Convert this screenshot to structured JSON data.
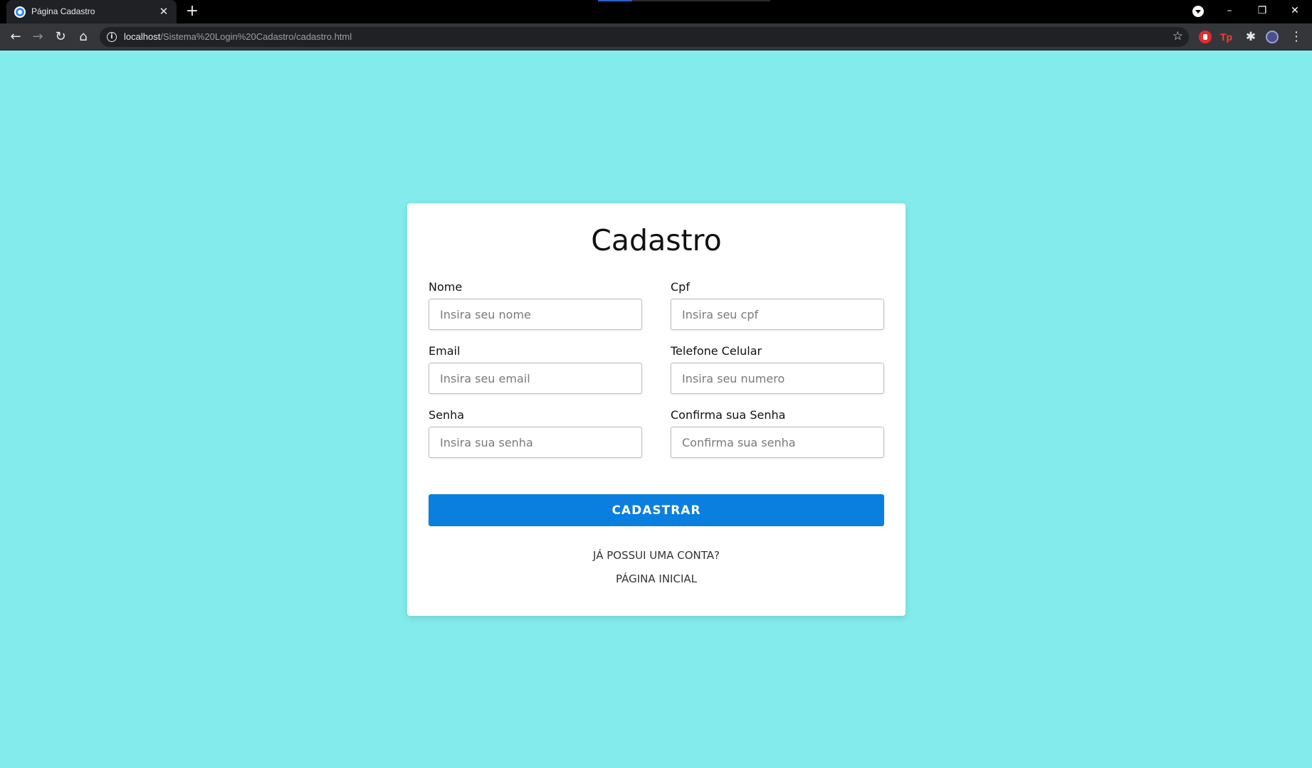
{
  "browser": {
    "tab_title": "Página Cadastro",
    "url_host": "localhost",
    "url_path": "/Sistema%20Login%20Cadastro/cadastro.html"
  },
  "form": {
    "title": "Cadastro",
    "fields": [
      {
        "label": "Nome",
        "placeholder": "Insira seu nome"
      },
      {
        "label": "Cpf",
        "placeholder": "Insira seu cpf"
      },
      {
        "label": "Email",
        "placeholder": "Insira seu email"
      },
      {
        "label": "Telefone Celular",
        "placeholder": "Insira seu numero"
      },
      {
        "label": "Senha",
        "placeholder": "Insira sua senha"
      },
      {
        "label": "Confirma sua Senha",
        "placeholder": "Confirma sua senha"
      }
    ],
    "submit_label": "CADASTRAR",
    "login_link": "JÁ POSSUI UMA CONTA?",
    "home_link": "PÁGINA INICIAL"
  },
  "colors": {
    "page_background": "#83ebeb",
    "button_primary": "#0a7fe0"
  }
}
